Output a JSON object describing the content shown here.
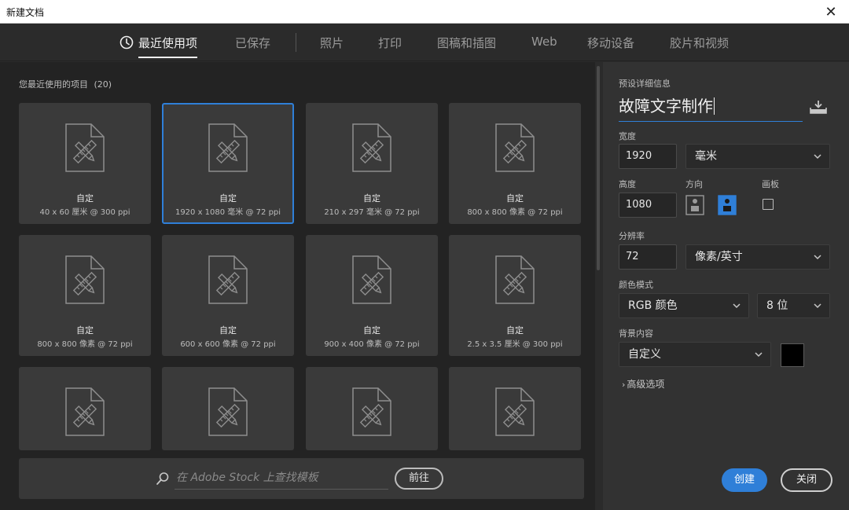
{
  "window": {
    "title": "新建文档",
    "close_glyph": "✕"
  },
  "tabs": [
    {
      "label": "最近使用项"
    },
    {
      "label": "已保存"
    },
    {
      "label": "照片"
    },
    {
      "label": "打印"
    },
    {
      "label": "图稿和插图"
    },
    {
      "label": "Web"
    },
    {
      "label": "移动设备"
    },
    {
      "label": "胶片和视频"
    }
  ],
  "recent": {
    "label": "您最近使用的项目",
    "count": "(20)",
    "items": [
      {
        "name": "自定",
        "dims": "40 x 60 厘米 @ 300 ppi"
      },
      {
        "name": "自定",
        "dims": "1920 x 1080 毫米 @ 72 ppi"
      },
      {
        "name": "自定",
        "dims": "210 x 297 毫米 @ 72 ppi"
      },
      {
        "name": "自定",
        "dims": "800 x 800 像素 @ 72 ppi"
      },
      {
        "name": "自定",
        "dims": "800 x 800 像素 @ 72 ppi"
      },
      {
        "name": "自定",
        "dims": "600 x 600 像素 @ 72 ppi"
      },
      {
        "name": "自定",
        "dims": "900 x 400 像素 @ 72 ppi"
      },
      {
        "name": "自定",
        "dims": "2.5 x 3.5 厘米 @ 300 ppi"
      }
    ]
  },
  "search": {
    "placeholder": "在 Adobe Stock 上查找模板",
    "go_label": "前往"
  },
  "details": {
    "section_label": "预设详细信息",
    "doc_name": "故障文字制作",
    "width_label": "宽度",
    "width_value": "1920",
    "unit_value": "毫米",
    "height_label": "高度",
    "height_value": "1080",
    "orientation_label": "方向",
    "artboard_label": "画板",
    "resolution_label": "分辨率",
    "resolution_value": "72",
    "resolution_unit": "像素/英寸",
    "color_mode_label": "颜色模式",
    "color_mode_value": "RGB 颜色",
    "bit_depth_value": "8 位",
    "background_label": "背景内容",
    "background_value": "自定义",
    "background_color": "#000000",
    "advanced_label": "高级选项"
  },
  "footer": {
    "create_label": "创建",
    "close_label": "关闭"
  },
  "colors": {
    "accent": "#2f7fd8"
  }
}
